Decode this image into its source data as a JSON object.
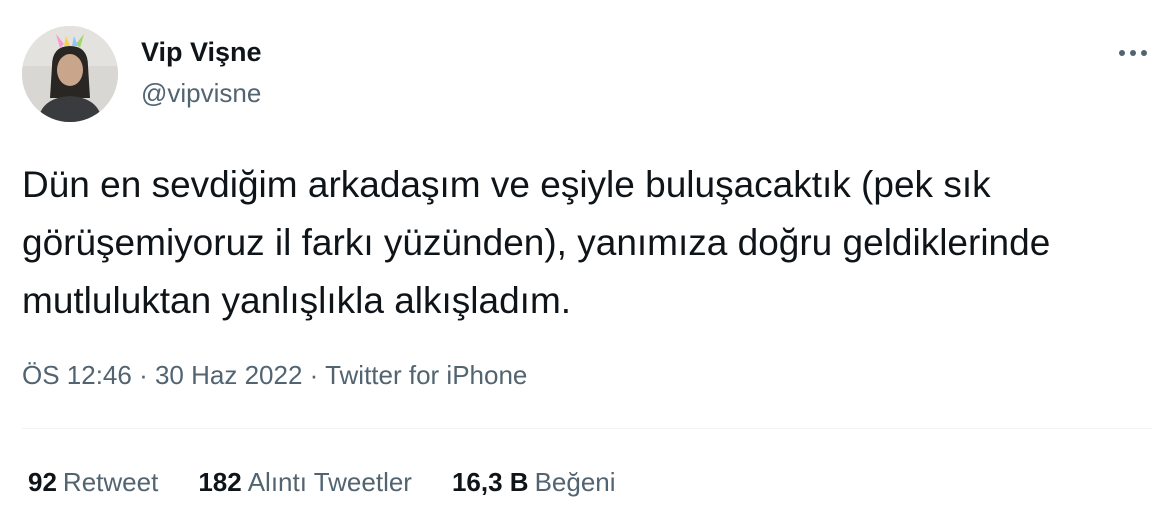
{
  "author": {
    "display_name": "Vip Vişne",
    "handle": "@vipvisne"
  },
  "tweet": {
    "text": "Dün en sevdiğim arkadaşım ve eşiyle buluşacaktık (pek sık görüşemiyoruz il farkı yüzünden), yanımıza doğru geldiklerinde mutluluktan yanlışlıkla alkışladım.",
    "time": "ÖS 12:46",
    "date": "30 Haz 2022",
    "source": "Twitter for iPhone",
    "separator": " · "
  },
  "stats": {
    "retweets": {
      "count": "92",
      "label": "Retweet"
    },
    "quotes": {
      "count": "182",
      "label": "Alıntı Tweetler"
    },
    "likes": {
      "count": "16,3 B",
      "label": "Beğeni"
    }
  },
  "icons": {
    "more": "more-options-icon"
  },
  "colors": {
    "text": "#0f1419",
    "secondary": "#536471",
    "divider": "#eff3f4"
  }
}
